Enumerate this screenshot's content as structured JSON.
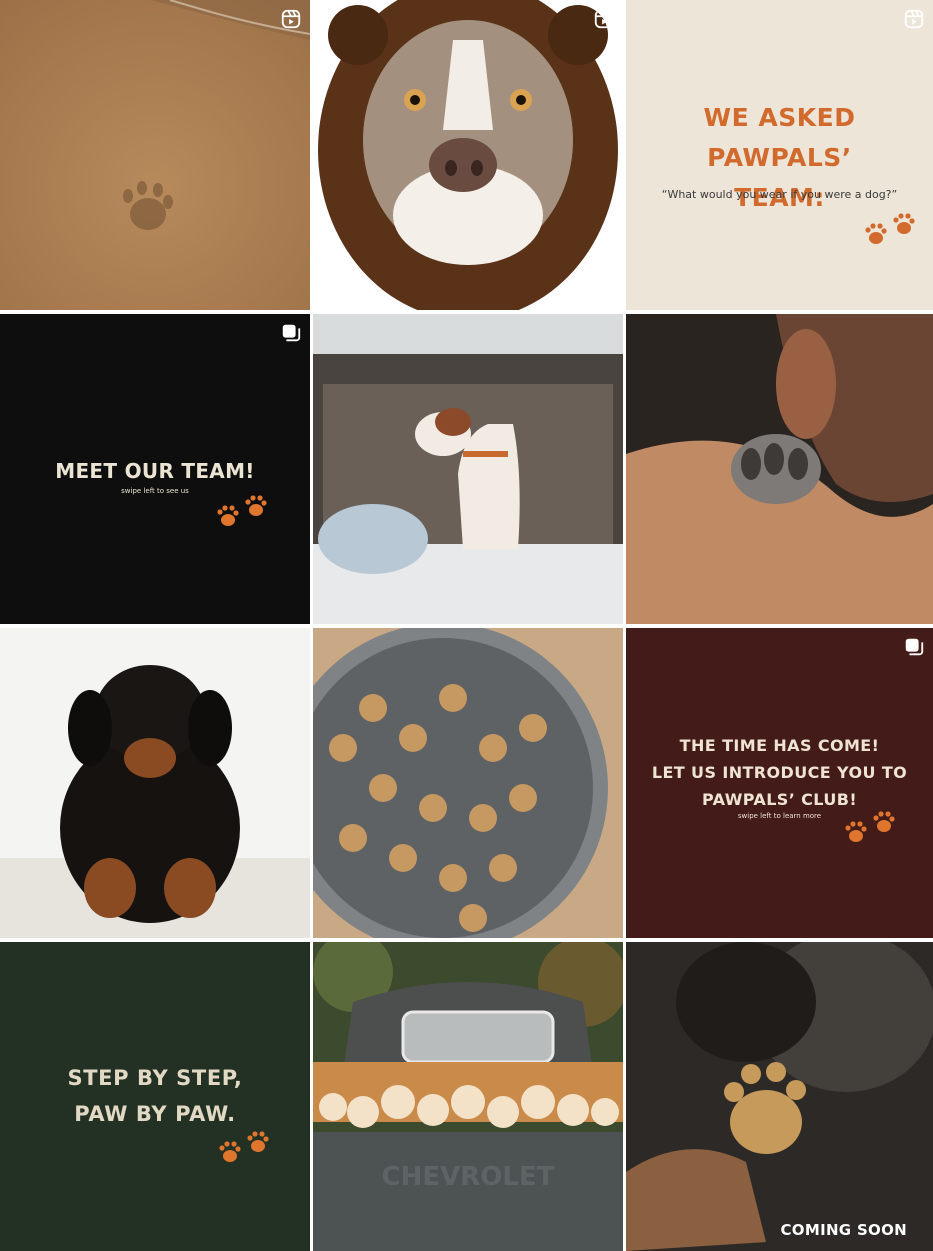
{
  "grid": {
    "tiles": [
      {
        "id": "beach-paw-print",
        "kind": "photo",
        "subject": "paw print in sand",
        "badge": "reel-icon"
      },
      {
        "id": "dog-bear-costume",
        "kind": "photo",
        "subject": "dog wearing bear costume",
        "badge": "reel-icon"
      },
      {
        "id": "we-asked-team",
        "kind": "graphic",
        "badge": "reel-icon",
        "heading_line1": "WE ASKED PAWPALS’",
        "heading_line2": "TEAM:",
        "quote": "“What would you wear if you were a dog?”",
        "bg_color": "#ece5d8",
        "accent": "#d16a2c"
      },
      {
        "id": "meet-our-team",
        "kind": "graphic",
        "badge": "carousel-icon",
        "heading": "MEET OUR TEAM!",
        "subtext": "swipe left to see us",
        "bg_color": "#0e0e0e",
        "accent": "#e0752d"
      },
      {
        "id": "dog-in-car",
        "kind": "photo",
        "subject": "dog in car window"
      },
      {
        "id": "paw-on-shoulder",
        "kind": "photo",
        "subject": "dog paw on shoulder"
      },
      {
        "id": "black-puppy",
        "kind": "photo",
        "subject": "black and tan puppy"
      },
      {
        "id": "treat-bowl",
        "kind": "photo",
        "subject": "bowl of bone treats"
      },
      {
        "id": "pawpals-club",
        "kind": "graphic",
        "badge": "carousel-icon",
        "heading_line1": "THE TIME HAS COME!",
        "heading_line2": "LET US INTRODUCE YOU TO",
        "heading_line3": "PAWPALS’ CLUB!",
        "subtext": "swipe left to learn more",
        "bg_color": "#431b18",
        "accent": "#e0752d"
      },
      {
        "id": "step-by-step",
        "kind": "graphic",
        "heading_line1": "STEP BY STEP,",
        "heading_line2": "PAW BY PAW.",
        "bg_color": "#233024",
        "accent": "#e0752d"
      },
      {
        "id": "puppies-truck",
        "kind": "photo",
        "subject": "puppies in truck bed",
        "truck_text": "CHEVROLET"
      },
      {
        "id": "coming-soon",
        "kind": "photo",
        "subject": "hand holding paw treat",
        "caption": "COMING SOON"
      }
    ]
  }
}
